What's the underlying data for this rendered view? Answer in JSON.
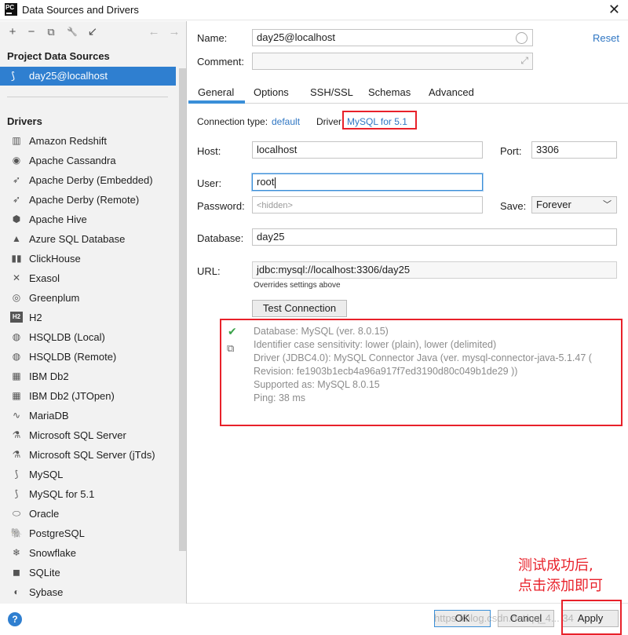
{
  "window": {
    "app_icon_text": "PC",
    "title": "Data Sources and Drivers",
    "close_glyph": "✕"
  },
  "left_toolbar": {
    "icons": [
      "add-icon",
      "remove-icon",
      "duplicate-icon",
      "wrench-icon",
      "move-icon",
      "back-arrow-icon",
      "forward-arrow-icon"
    ],
    "glyphs": [
      "+",
      "−",
      "⧉",
      "🔧",
      "↙",
      "←",
      "→"
    ]
  },
  "project_section": {
    "title": "Project Data Sources",
    "selected_item": "day25@localhost"
  },
  "drivers_section": {
    "title": "Drivers",
    "items": [
      {
        "label": "Amazon Redshift",
        "icon": "redshift-icon",
        "glyph": "▥"
      },
      {
        "label": "Apache Cassandra",
        "icon": "cassandra-icon",
        "glyph": "◉"
      },
      {
        "label": "Apache Derby (Embedded)",
        "icon": "derby-icon",
        "glyph": "➶"
      },
      {
        "label": "Apache Derby (Remote)",
        "icon": "derby-icon",
        "glyph": "➶"
      },
      {
        "label": "Apache Hive",
        "icon": "hive-icon",
        "glyph": "⬢"
      },
      {
        "label": "Azure SQL Database",
        "icon": "azure-icon",
        "glyph": "▲"
      },
      {
        "label": "ClickHouse",
        "icon": "clickhouse-icon",
        "glyph": "▮▮"
      },
      {
        "label": "Exasol",
        "icon": "exasol-icon",
        "glyph": "✕"
      },
      {
        "label": "Greenplum",
        "icon": "greenplum-icon",
        "glyph": "◎"
      },
      {
        "label": "H2",
        "icon": "h2-icon",
        "glyph": "H2"
      },
      {
        "label": "HSQLDB (Local)",
        "icon": "hsqldb-icon",
        "glyph": "◍"
      },
      {
        "label": "HSQLDB (Remote)",
        "icon": "hsqldb-icon",
        "glyph": "◍"
      },
      {
        "label": "IBM Db2",
        "icon": "ibm-icon",
        "glyph": "▦"
      },
      {
        "label": "IBM Db2 (JTOpen)",
        "icon": "ibm-icon",
        "glyph": "▦"
      },
      {
        "label": "MariaDB",
        "icon": "mariadb-icon",
        "glyph": "∿"
      },
      {
        "label": "Microsoft SQL Server",
        "icon": "mssql-icon",
        "glyph": "⚗"
      },
      {
        "label": "Microsoft SQL Server (jTds)",
        "icon": "mssql-icon",
        "glyph": "⚗"
      },
      {
        "label": "MySQL",
        "icon": "mysql-icon",
        "glyph": "⟆"
      },
      {
        "label": "MySQL for 5.1",
        "icon": "mysql-icon",
        "glyph": "⟆"
      },
      {
        "label": "Oracle",
        "icon": "oracle-icon",
        "glyph": "⬭"
      },
      {
        "label": "PostgreSQL",
        "icon": "postgresql-icon",
        "glyph": "🐘"
      },
      {
        "label": "Snowflake",
        "icon": "snowflake-icon",
        "glyph": "❄"
      },
      {
        "label": "SQLite",
        "icon": "sqlite-icon",
        "glyph": "◼"
      },
      {
        "label": "Sybase",
        "icon": "sybase-icon",
        "glyph": "◐"
      }
    ]
  },
  "form": {
    "name_label": "Name:",
    "name_value": "day25@localhost",
    "comment_label": "Comment:",
    "comment_value": "",
    "reset_label": "Reset",
    "tabs": [
      "General",
      "Options",
      "SSH/SSL",
      "Schemas",
      "Advanced"
    ],
    "active_tab": "General",
    "connection_type_label": "Connection type:",
    "connection_type_value": "default",
    "driver_label": "Driver:",
    "driver_value": "MySQL for 5.1",
    "host_label": "Host:",
    "host_value": "localhost",
    "port_label": "Port:",
    "port_value": "3306",
    "user_label": "User:",
    "user_value": "root",
    "password_label": "Password:",
    "password_placeholder": "<hidden>",
    "save_label": "Save:",
    "save_value": "Forever",
    "database_label": "Database:",
    "database_value": "day25",
    "url_label": "URL:",
    "url_value": "jdbc:mysql://localhost:3306/day25",
    "overrides_note": "Overrides settings above",
    "test_button": "Test Connection"
  },
  "test_result": {
    "lines": [
      "Database: MySQL (ver. 8.0.15)",
      "Identifier case sensitivity: lower (plain), lower (delimited)",
      "Driver (JDBC4.0): MySQL Connector Java (ver. mysql-connector-java-5.1.47 (",
      "Revision: fe1903b1ecb4a96a917f7ed3190d80c049b1de29 ))",
      "Supported as: MySQL 8.0.15",
      "Ping: 38 ms"
    ]
  },
  "annotation": {
    "line1": "测试成功后,",
    "line2": "点击添加即可"
  },
  "footer": {
    "help": "?",
    "ok": "OK",
    "cancel": "Cancel",
    "apply": "Apply",
    "watermark": "https://blog.csdn.net/qq_4... 34"
  },
  "colors": {
    "accent": "#2f7fd0",
    "annotation_red": "#e8212a",
    "success_green": "#3aa24a"
  }
}
